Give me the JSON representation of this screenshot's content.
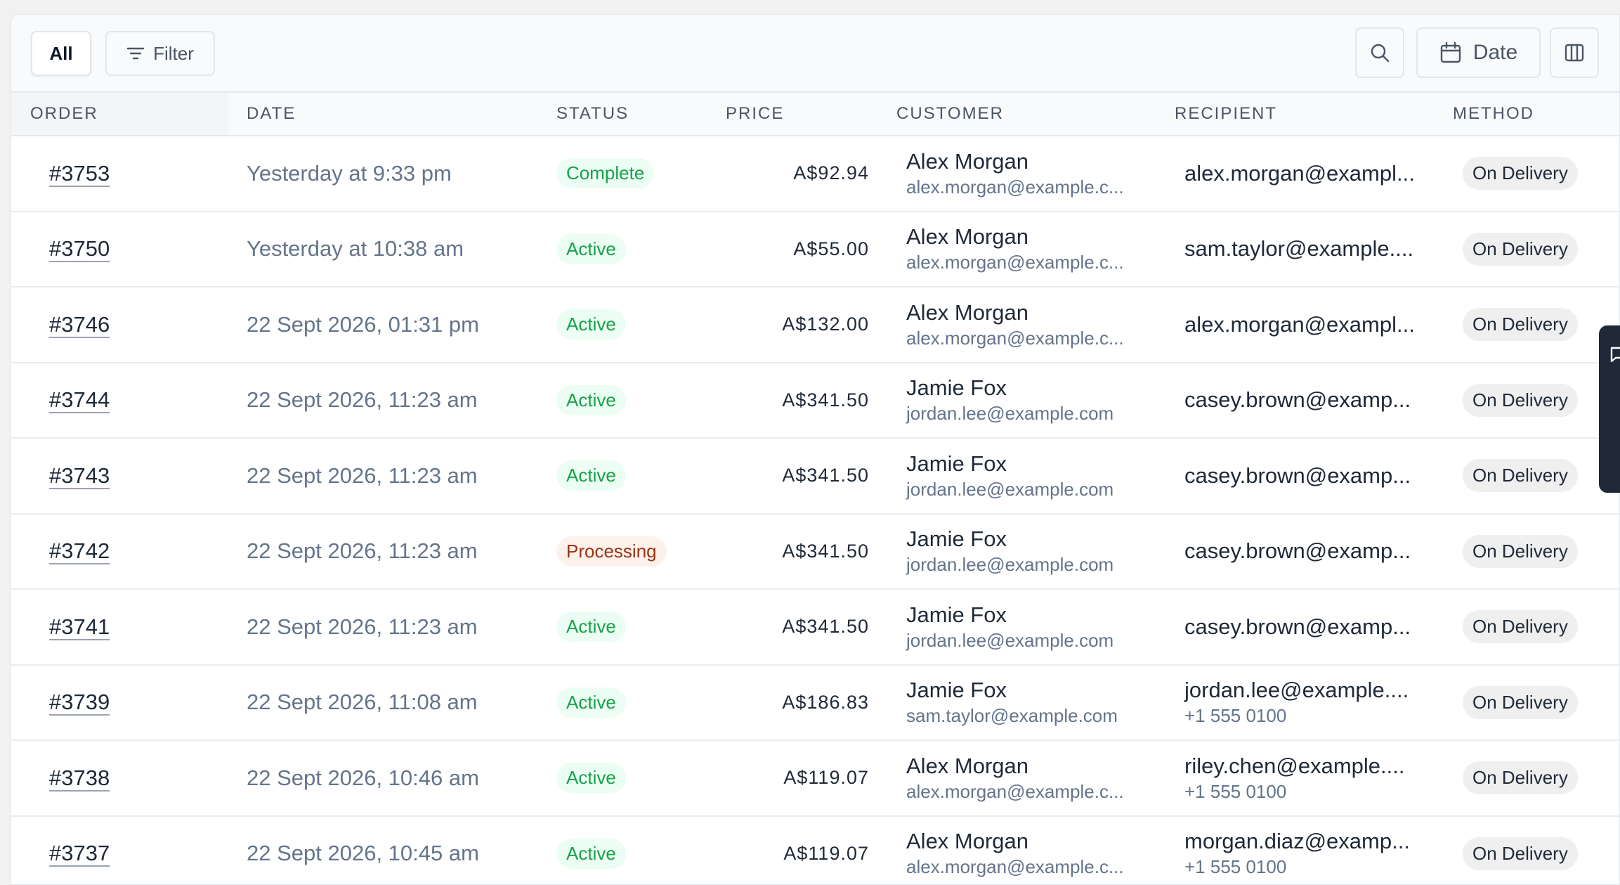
{
  "toolbar": {
    "all_label": "All",
    "filter_label": "Filter",
    "date_label": "Date"
  },
  "columns": {
    "order": "ORDER",
    "date": "DATE",
    "status": "STATUS",
    "price": "PRICE",
    "customer": "CUSTOMER",
    "recipient": "RECIPIENT",
    "method": "METHOD"
  },
  "orders": [
    {
      "id": "#3753",
      "date": "Yesterday at 9:33 pm",
      "status": "Complete",
      "status_kind": "complete",
      "price": "A$92.94",
      "customer_name": "Alex Morgan",
      "customer_email": "alex.morgan@example.c...",
      "recipient_email": "alex.morgan@exampl...",
      "recipient_phone": "",
      "method": "On Delivery"
    },
    {
      "id": "#3750",
      "date": "Yesterday at 10:38 am",
      "status": "Active",
      "status_kind": "active",
      "price": "A$55.00",
      "customer_name": "Alex Morgan",
      "customer_email": "alex.morgan@example.c...",
      "recipient_email": "sam.taylor@example....",
      "recipient_phone": "",
      "method": "On Delivery"
    },
    {
      "id": "#3746",
      "date": "22 Sept 2026, 01:31 pm",
      "status": "Active",
      "status_kind": "active",
      "price": "A$132.00",
      "customer_name": "Alex Morgan",
      "customer_email": "alex.morgan@example.c...",
      "recipient_email": "alex.morgan@exampl...",
      "recipient_phone": "",
      "method": "On Delivery"
    },
    {
      "id": "#3744",
      "date": "22 Sept 2026, 11:23 am",
      "status": "Active",
      "status_kind": "active",
      "price": "A$341.50",
      "customer_name": "Jamie Fox",
      "customer_email": "jordan.lee@example.com",
      "recipient_email": "casey.brown@examp...",
      "recipient_phone": "",
      "method": "On Delivery"
    },
    {
      "id": "#3743",
      "date": "22 Sept 2026, 11:23 am",
      "status": "Active",
      "status_kind": "active",
      "price": "A$341.50",
      "customer_name": "Jamie Fox",
      "customer_email": "jordan.lee@example.com",
      "recipient_email": "casey.brown@examp...",
      "recipient_phone": "",
      "method": "On Delivery"
    },
    {
      "id": "#3742",
      "date": "22 Sept 2026, 11:23 am",
      "status": "Processing",
      "status_kind": "processing",
      "price": "A$341.50",
      "customer_name": "Jamie Fox",
      "customer_email": "jordan.lee@example.com",
      "recipient_email": "casey.brown@examp...",
      "recipient_phone": "",
      "method": "On Delivery"
    },
    {
      "id": "#3741",
      "date": "22 Sept 2026, 11:23 am",
      "status": "Active",
      "status_kind": "active",
      "price": "A$341.50",
      "customer_name": "Jamie Fox",
      "customer_email": "jordan.lee@example.com",
      "recipient_email": "casey.brown@examp...",
      "recipient_phone": "",
      "method": "On Delivery"
    },
    {
      "id": "#3739",
      "date": "22 Sept 2026, 11:08 am",
      "status": "Active",
      "status_kind": "active",
      "price": "A$186.83",
      "customer_name": "Jamie Fox",
      "customer_email": "sam.taylor@example.com",
      "recipient_email": "jordan.lee@example....",
      "recipient_phone": "+1 555 0100",
      "method": "On Delivery"
    },
    {
      "id": "#3738",
      "date": "22 Sept 2026, 10:46 am",
      "status": "Active",
      "status_kind": "active",
      "price": "A$119.07",
      "customer_name": "Alex Morgan",
      "customer_email": "alex.morgan@example.c...",
      "recipient_email": "riley.chen@example....",
      "recipient_phone": "+1 555 0100",
      "method": "On Delivery"
    },
    {
      "id": "#3737",
      "date": "22 Sept 2026, 10:45 am",
      "status": "Active",
      "status_kind": "active",
      "price": "A$119.07",
      "customer_name": "Alex Morgan",
      "customer_email": "alex.morgan@example.c...",
      "recipient_email": "morgan.diaz@examp...",
      "recipient_phone": "+1 555 0100",
      "method": "On Delivery"
    }
  ],
  "icons": {
    "filter": "filter-lines-icon",
    "search": "search-icon",
    "date": "calendar-icon",
    "columns": "columns-icon",
    "feedback": "chat-bubble-icon"
  },
  "colors": {
    "status_active": "#16a34a",
    "status_processing": "#9a3412",
    "side_tab": "#1f2937"
  }
}
